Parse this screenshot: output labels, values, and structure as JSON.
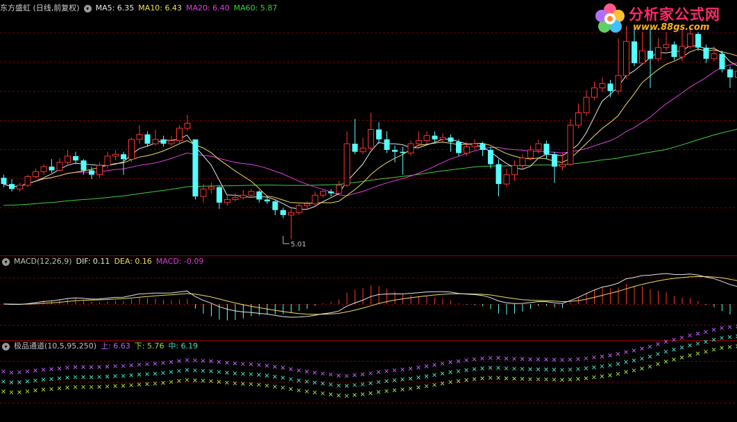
{
  "main_panel": {
    "title": "东方盛虹 (日线,前复权)",
    "ma": [
      {
        "label": "MA5: 6.35",
        "color": "#e8e8e8"
      },
      {
        "label": "MA10: 6.43",
        "color": "#f0e060"
      },
      {
        "label": "MA20: 6.40",
        "color": "#e040e0"
      },
      {
        "label": "MA60: 5.87",
        "color": "#40d040"
      }
    ],
    "low_marker": "5.01"
  },
  "macd_panel": {
    "title": "MACD(12,26,9)",
    "dif": "DIF: 0.11",
    "dea": "DEA: 0.16",
    "macd": "MACD: -0.09"
  },
  "channel_panel": {
    "title": "极品通道(10,5,95,250)",
    "upper": "上: 6.63",
    "lower": "下: 5.76",
    "middle": "中: 6.19"
  },
  "logo": {
    "name": "分析家公式网",
    "url": "www.88gs.com"
  },
  "colors": {
    "up": "#ff3232",
    "down": "#54ffff",
    "grid": "#7a0000",
    "ma5": "#e8e8e8",
    "ma10": "#f0e060",
    "ma20": "#e040e0",
    "ma60": "#40d040",
    "ch_upper": "#c060ff",
    "ch_mid": "#40e0c0",
    "ch_lower": "#a0e040"
  },
  "chart_data": {
    "type": "candlestick",
    "series": [
      {
        "name": "MA5",
        "value": 6.35
      },
      {
        "name": "MA10",
        "value": 6.43
      },
      {
        "name": "MA20",
        "value": 6.4
      },
      {
        "name": "MA60",
        "value": 5.87
      }
    ],
    "annotations": [
      "5.01"
    ],
    "candles": [
      [
        6.0,
        5.9,
        6.05,
        5.85
      ],
      [
        5.9,
        5.82,
        5.98,
        5.78
      ],
      [
        5.82,
        5.88,
        5.92,
        5.78
      ],
      [
        5.88,
        6.02,
        6.05,
        5.85
      ],
      [
        6.02,
        6.1,
        6.15,
        6.0
      ],
      [
        6.1,
        6.18,
        6.22,
        6.05
      ],
      [
        6.18,
        6.12,
        6.3,
        6.08
      ],
      [
        6.12,
        6.25,
        6.32,
        6.1
      ],
      [
        6.25,
        6.35,
        6.45,
        6.2
      ],
      [
        6.35,
        6.28,
        6.42,
        6.22
      ],
      [
        6.28,
        6.12,
        6.3,
        6.05
      ],
      [
        6.12,
        6.05,
        6.18,
        5.98
      ],
      [
        6.05,
        6.2,
        6.25,
        6.0
      ],
      [
        6.2,
        6.35,
        6.42,
        6.15
      ],
      [
        6.35,
        6.38,
        6.45,
        6.28
      ],
      [
        6.38,
        6.3,
        6.42,
        6.05
      ],
      [
        6.3,
        6.62,
        6.65,
        6.25
      ],
      [
        6.62,
        6.7,
        6.85,
        6.55
      ],
      [
        6.7,
        6.55,
        6.75,
        6.5
      ],
      [
        6.55,
        6.62,
        6.78,
        6.52
      ],
      [
        6.62,
        6.55,
        6.68,
        6.5
      ],
      [
        6.55,
        6.6,
        6.68,
        6.52
      ],
      [
        6.6,
        6.8,
        6.85,
        6.55
      ],
      [
        6.8,
        6.88,
        7.02,
        6.75
      ],
      [
        6.62,
        5.7,
        6.35,
        5.65
      ],
      [
        5.7,
        5.82,
        5.9,
        5.6
      ],
      [
        5.82,
        5.85,
        5.92,
        5.75
      ],
      [
        5.85,
        5.6,
        5.88,
        5.5
      ],
      [
        5.6,
        5.65,
        5.72,
        5.55
      ],
      [
        5.65,
        5.68,
        5.75,
        5.62
      ],
      [
        5.68,
        5.72,
        5.8,
        5.65
      ],
      [
        5.72,
        5.78,
        5.82,
        5.68
      ],
      [
        5.78,
        5.65,
        5.8,
        5.6
      ],
      [
        5.65,
        5.62,
        5.7,
        5.58
      ],
      [
        5.62,
        5.48,
        5.65,
        5.4
      ],
      [
        5.48,
        5.4,
        5.52,
        5.35
      ],
      [
        5.4,
        5.44,
        5.5,
        5.01
      ],
      [
        5.44,
        5.55,
        5.6,
        5.4
      ],
      [
        5.55,
        5.58,
        5.62,
        5.5
      ],
      [
        5.58,
        5.72,
        5.78,
        5.55
      ],
      [
        5.72,
        5.78,
        5.8,
        5.68
      ],
      [
        5.78,
        5.75,
        5.82,
        5.7
      ],
      [
        5.75,
        5.88,
        5.95,
        5.72
      ],
      [
        5.88,
        6.55,
        6.75,
        5.85
      ],
      [
        6.55,
        6.42,
        6.95,
        6.38
      ],
      [
        6.42,
        6.48,
        6.65,
        6.38
      ],
      [
        6.48,
        6.78,
        7.05,
        6.45
      ],
      [
        6.78,
        6.62,
        6.9,
        6.55
      ],
      [
        6.62,
        6.45,
        6.75,
        6.4
      ],
      [
        6.45,
        6.42,
        6.52,
        6.25
      ],
      [
        6.42,
        6.4,
        6.5,
        6.05
      ],
      [
        6.4,
        6.55,
        6.6,
        6.35
      ],
      [
        6.55,
        6.6,
        6.75,
        6.5
      ],
      [
        6.6,
        6.68,
        6.75,
        6.55
      ],
      [
        6.68,
        6.62,
        6.75,
        6.58
      ],
      [
        6.62,
        6.65,
        6.72,
        6.58
      ],
      [
        6.65,
        6.58,
        6.7,
        6.42
      ],
      [
        6.58,
        6.4,
        6.62,
        6.35
      ],
      [
        6.4,
        6.5,
        6.58,
        6.35
      ],
      [
        6.5,
        6.55,
        6.62,
        6.45
      ],
      [
        6.55,
        6.45,
        6.58,
        6.35
      ],
      [
        6.45,
        6.22,
        6.5,
        6.15
      ],
      [
        6.22,
        5.9,
        6.3,
        5.7
      ],
      [
        5.9,
        6.05,
        6.15,
        5.85
      ],
      [
        6.05,
        6.2,
        6.28,
        5.95
      ],
      [
        6.2,
        6.32,
        6.38,
        6.15
      ],
      [
        6.32,
        6.45,
        6.52,
        6.28
      ],
      [
        6.45,
        6.55,
        6.62,
        6.4
      ],
      [
        6.55,
        6.38,
        6.6,
        6.3
      ],
      [
        6.38,
        6.18,
        6.42,
        5.92
      ],
      [
        6.18,
        6.22,
        6.4,
        6.12
      ],
      [
        6.22,
        6.85,
        6.95,
        6.2
      ],
      [
        6.85,
        7.05,
        7.2,
        6.8
      ],
      [
        7.05,
        7.3,
        7.42,
        7.0
      ],
      [
        7.3,
        7.45,
        7.55,
        7.25
      ],
      [
        7.45,
        7.52,
        7.62,
        7.38
      ],
      [
        7.52,
        7.4,
        7.58,
        7.3
      ],
      [
        7.4,
        7.65,
        8.25,
        7.35
      ],
      [
        7.65,
        8.2,
        8.45,
        7.6
      ],
      [
        8.2,
        7.85,
        8.4,
        7.8
      ],
      [
        7.85,
        8.05,
        8.35,
        7.82
      ],
      [
        8.05,
        7.92,
        8.4,
        7.45
      ],
      [
        7.92,
        8.1,
        8.25,
        7.88
      ],
      [
        8.1,
        8.15,
        8.35,
        8.05
      ],
      [
        8.15,
        7.95,
        8.2,
        7.9
      ],
      [
        7.95,
        8.12,
        8.4,
        7.88
      ],
      [
        8.12,
        8.32,
        8.45,
        8.08
      ],
      [
        8.32,
        8.1,
        8.35,
        8.05
      ],
      [
        8.1,
        7.92,
        8.15,
        7.85
      ],
      [
        7.92,
        8.0,
        8.12,
        7.88
      ],
      [
        8.0,
        7.75,
        8.05,
        7.7
      ],
      [
        7.75,
        7.62,
        7.8,
        7.45
      ],
      [
        7.62,
        7.72,
        7.78,
        7.58
      ]
    ]
  }
}
